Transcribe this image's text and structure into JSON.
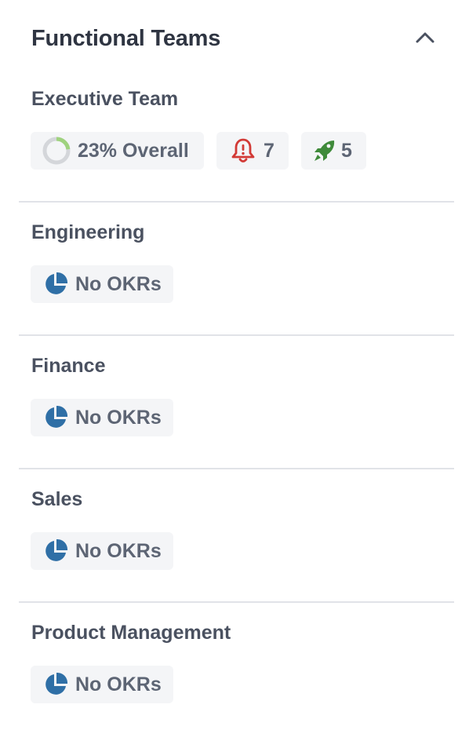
{
  "panel": {
    "title": "Functional Teams",
    "collapse_icon": "chevron-up-icon"
  },
  "colors": {
    "progress_track": "#d4d6da",
    "progress_fill": "#9fd27e",
    "alert": "#d23a36",
    "rocket": "#3f8a3a",
    "no_okr_icon": "#2f6fa6",
    "chip_bg": "#f4f5f7",
    "divider": "#e1e3e8"
  },
  "teams": [
    {
      "name": "Executive Team",
      "overall": {
        "label": "23% Overall",
        "progress": 0.23,
        "icon": "progress-ring-icon"
      },
      "alerts": {
        "count": "7",
        "icon": "alert-bell-icon"
      },
      "rockets": {
        "count": "5",
        "icon": "rocket-icon"
      }
    },
    {
      "name": "Engineering",
      "status": {
        "label": "No OKRs",
        "icon": "pie-chart-icon"
      }
    },
    {
      "name": "Finance",
      "status": {
        "label": "No OKRs",
        "icon": "pie-chart-icon"
      }
    },
    {
      "name": "Sales",
      "status": {
        "label": "No OKRs",
        "icon": "pie-chart-icon"
      }
    },
    {
      "name": "Product Management",
      "status": {
        "label": "No OKRs",
        "icon": "pie-chart-icon"
      }
    }
  ]
}
